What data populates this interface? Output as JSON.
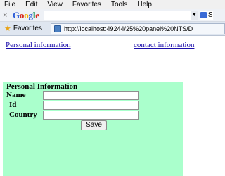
{
  "menubar": {
    "items": [
      "File",
      "Edit",
      "View",
      "Favorites",
      "Tools",
      "Help"
    ]
  },
  "toolbar": {
    "close_icon": "close-x-icon",
    "google_logo": "Google",
    "search_value": "",
    "search_button_label": "S"
  },
  "favorites_bar": {
    "favorites_label": "Favorites",
    "tab_url": "http://localhost:49244/25%20panel%20NTS/D"
  },
  "nav_links": {
    "personal": "Personal information",
    "contact": "contact information"
  },
  "panel": {
    "title": "Personal Information",
    "background": "#aaffcc",
    "fields": {
      "name_label": "Name",
      "id_label": "Id",
      "country_label": "Country",
      "name_value": "",
      "id_value": "",
      "country_value": ""
    },
    "save_label": "Save"
  }
}
